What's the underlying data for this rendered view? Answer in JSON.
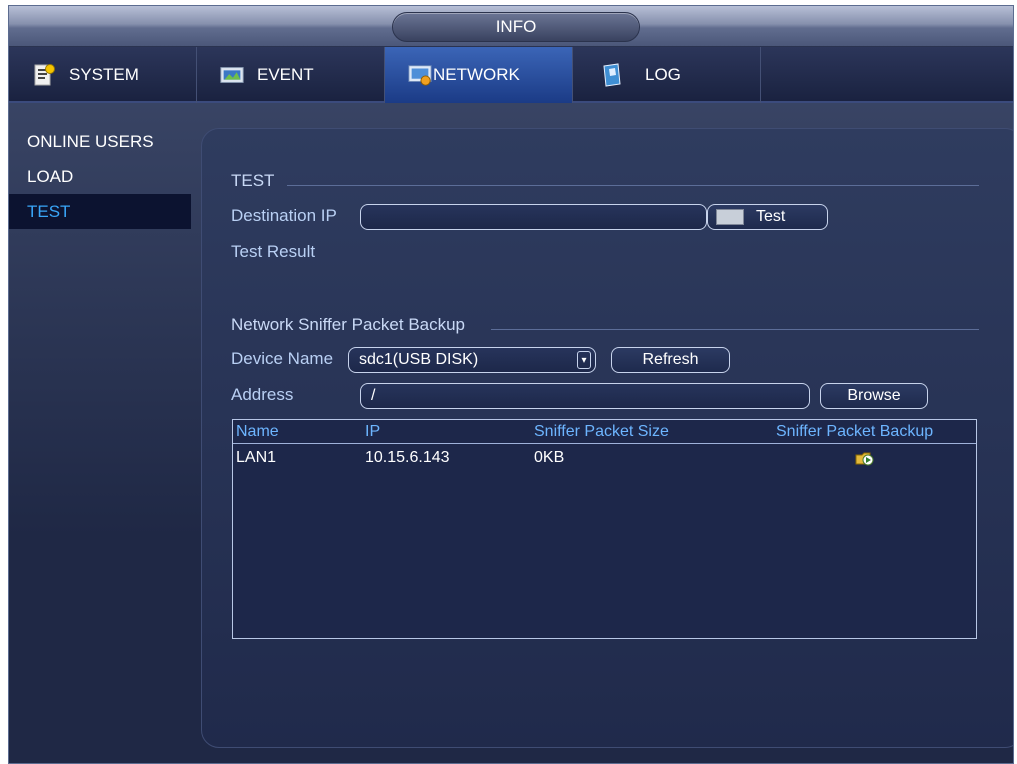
{
  "window": {
    "title": "INFO"
  },
  "tabs": [
    {
      "label": "SYSTEM",
      "icon": "system-settings-icon"
    },
    {
      "label": "EVENT",
      "icon": "event-icon"
    },
    {
      "label": "NETWORK",
      "icon": "network-icon",
      "active": true
    },
    {
      "label": "LOG",
      "icon": "log-book-icon"
    }
  ],
  "sidebar": {
    "items": [
      {
        "label": "ONLINE USERS"
      },
      {
        "label": "LOAD"
      },
      {
        "label": "TEST",
        "active": true
      }
    ]
  },
  "test": {
    "section_title": "TEST",
    "destination_label": "Destination IP",
    "destination_value": "",
    "test_button": "Test",
    "result_label": "Test Result"
  },
  "sniffer": {
    "section_title": "Network Sniffer Packet Backup",
    "device_label": "Device Name",
    "device_value": "sdc1(USB DISK)",
    "refresh_button": "Refresh",
    "address_label": "Address",
    "address_value": "/",
    "browse_button": "Browse",
    "columns": [
      "Name",
      "IP",
      "Sniffer Packet Size",
      "Sniffer Packet Backup"
    ],
    "rows": [
      {
        "name": "LAN1",
        "ip": "10.15.6.143",
        "size": "0KB",
        "backup_icon": "backup-start-icon"
      }
    ]
  },
  "colors": {
    "accent_blue": "#39a6f8",
    "header_blue": "#6db5ff",
    "active_tab": "#2a4f9f"
  }
}
